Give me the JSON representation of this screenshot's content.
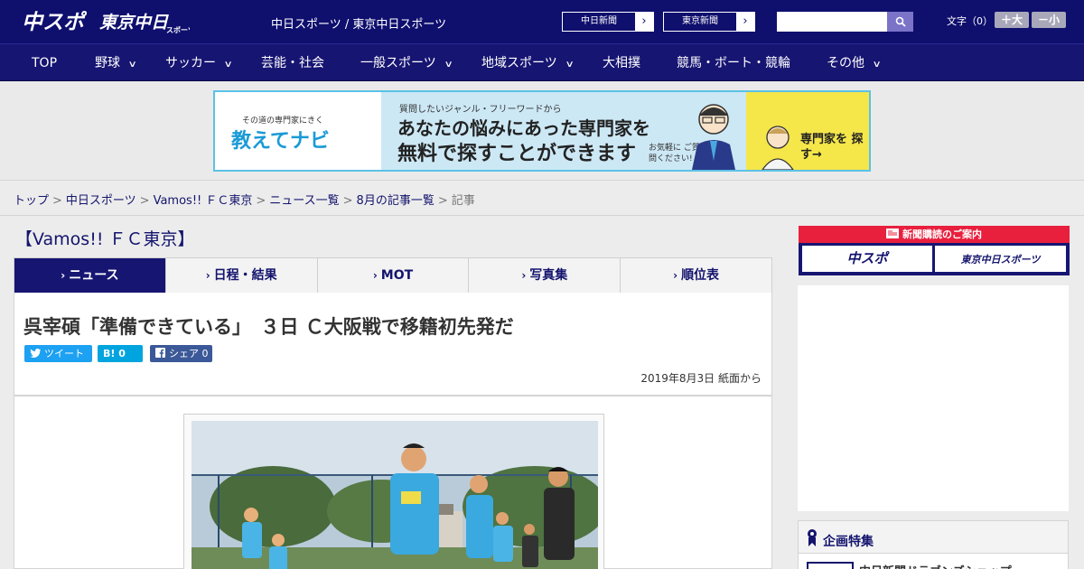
{
  "header": {
    "logo_chuspo": "中スポ",
    "logo_tokyo": "東京中日",
    "logo_tokyo_sub": "スポーツ",
    "site_title": "中日スポーツ / 東京中日スポーツ",
    "paper_links": [
      {
        "label": "中日新聞",
        "arrow": "›"
      },
      {
        "label": "東京新聞",
        "arrow": "›"
      }
    ],
    "search": {
      "value": ""
    },
    "font_size": {
      "label": "文字（0）",
      "bigger": "＋大",
      "smaller": "－小"
    }
  },
  "nav": {
    "items": [
      {
        "label": "TOP",
        "has_dropdown": false
      },
      {
        "label": "野球",
        "has_dropdown": true
      },
      {
        "label": "サッカー",
        "has_dropdown": true
      },
      {
        "label": "芸能・社会",
        "has_dropdown": false
      },
      {
        "label": "一般スポーツ",
        "has_dropdown": true
      },
      {
        "label": "地域スポーツ",
        "has_dropdown": true
      },
      {
        "label": "大相撲",
        "has_dropdown": false
      },
      {
        "label": "競馬・ボート・競輪",
        "has_dropdown": false
      },
      {
        "label": "その他",
        "has_dropdown": true
      }
    ],
    "chevron": "∨"
  },
  "banner": {
    "tagline": "その道の専門家にきく",
    "logo": "教えてナビ",
    "question": "質問したいジャンル・フリーワードから",
    "headline1": "あなたの悩みにあった専門家を",
    "headline2": "無料で探すことができます",
    "small_note": "お気軽に ご質問ください!",
    "cta": "専門家を 探す→"
  },
  "breadcrumb": {
    "items": [
      "トップ",
      "中日スポーツ",
      "Vamos!! ＦＣ東京",
      "ニュース一覧",
      "8月の記事一覧"
    ],
    "current": "記事",
    "separator": ">"
  },
  "section": {
    "title": "【Vamos!! ＦＣ東京】"
  },
  "tabs": {
    "chevron": "›",
    "items": [
      {
        "label": "ニュース",
        "active": true
      },
      {
        "label": "日程・結果",
        "active": false
      },
      {
        "label": "MOT",
        "active": false
      },
      {
        "label": "写真集",
        "active": false
      },
      {
        "label": "順位表",
        "active": false
      }
    ]
  },
  "article": {
    "headline": "呉宰碩「準備できている」　３日 Ｃ大阪戦で移籍初先発だ",
    "share": {
      "tweet": "ツイート",
      "hatena": "B! 0",
      "facebook": "シェア 0"
    },
    "date": "2019年8月3日 紙面から"
  },
  "sidebar": {
    "subscribe_title": "新聞購読のご案内",
    "subscribe_buttons": [
      "中スポ",
      "東京中日スポーツ"
    ],
    "feature_title": "企画特集",
    "feature_item": "中日新聞ドラゴンズショップ"
  },
  "colors": {
    "navy": "#0f0f6e",
    "nav": "#171572",
    "accent_red": "#e81f3d",
    "twitter": "#1da1f2",
    "hatena": "#00a4de",
    "facebook": "#3b5998"
  }
}
